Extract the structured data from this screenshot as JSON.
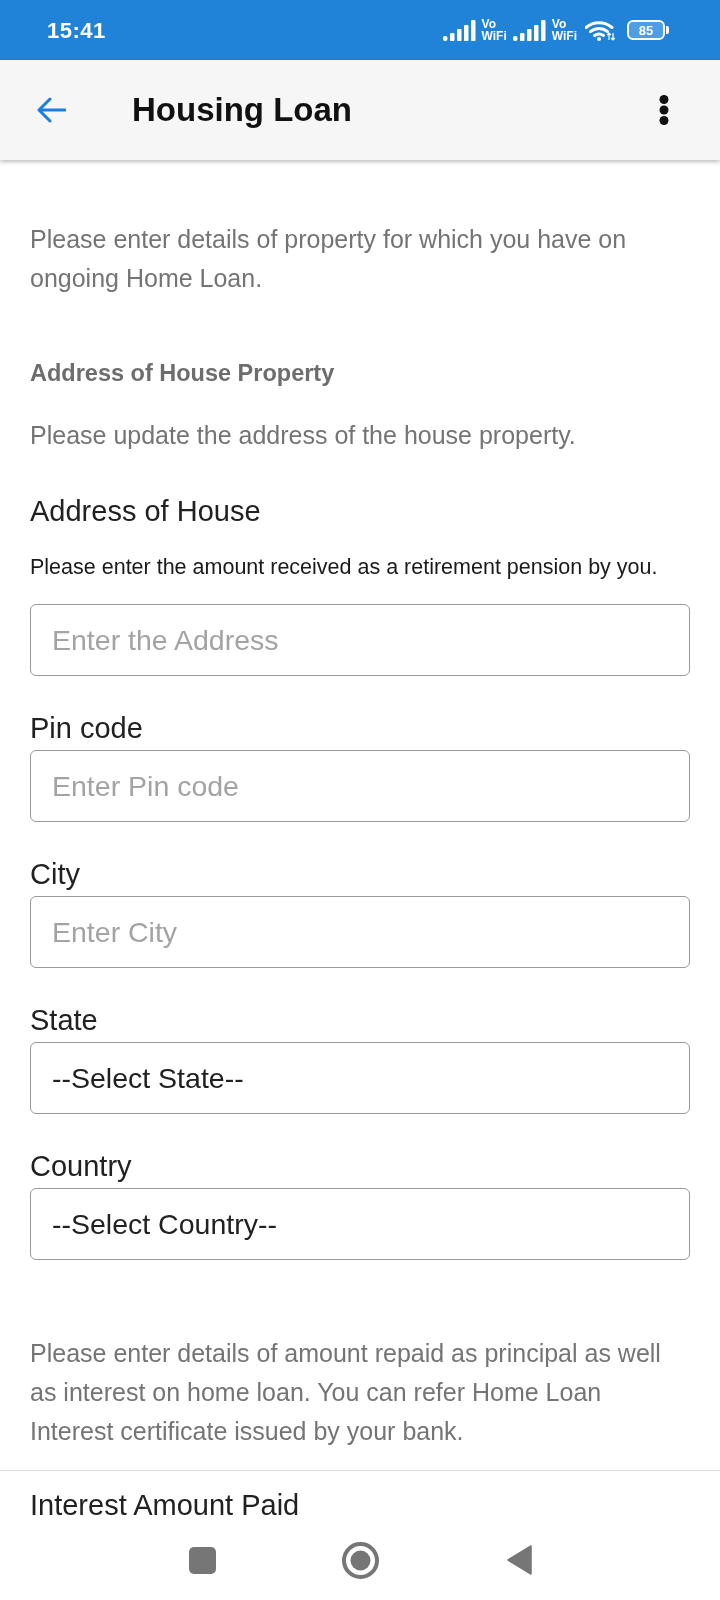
{
  "status_bar": {
    "time": "15:41",
    "networks": [
      {
        "top": "Vo",
        "bottom": "WiFi"
      },
      {
        "top": "Vo",
        "bottom": "WiFi"
      }
    ],
    "battery": "85"
  },
  "app_bar": {
    "title": "Housing Loan"
  },
  "intro": "Please enter details of property for which you have on ongoing Home Loan.",
  "section": {
    "heading": "Address of House Property",
    "description": "Please update the address of the house property."
  },
  "fields": [
    {
      "kind": "text",
      "label": "Address of House",
      "hint": "Please enter the amount received as a retirement pension by you.",
      "placeholder": "Enter the Address"
    },
    {
      "kind": "text",
      "label": "Pin code",
      "placeholder": "Enter Pin code"
    },
    {
      "kind": "text",
      "label": "City",
      "placeholder": "Enter City"
    },
    {
      "kind": "select",
      "label": "State",
      "value": "--Select State--"
    },
    {
      "kind": "select",
      "label": "Country",
      "value": "--Select Country--"
    }
  ],
  "repayment": {
    "description": "Please enter details of amount repaid as principal as well as interest on home loan. You can refer Home Loan Interest certificate issued by your bank.",
    "field_label": "Interest Amount Paid"
  }
}
